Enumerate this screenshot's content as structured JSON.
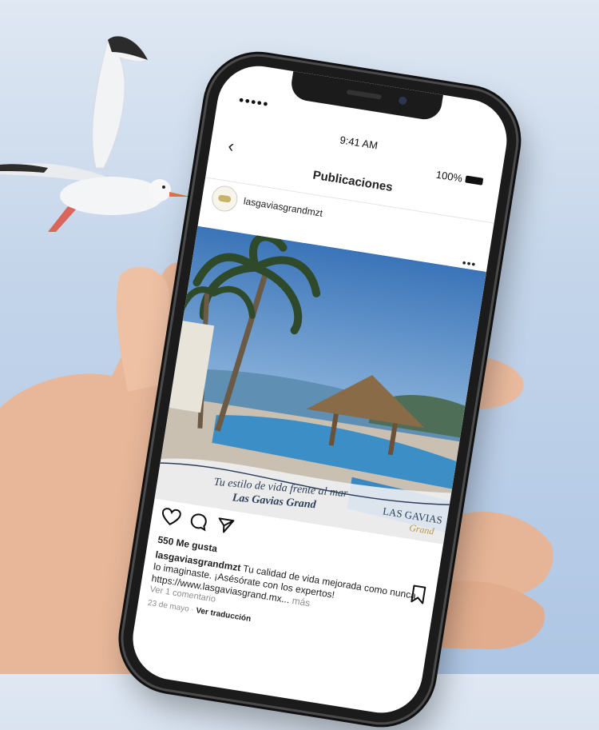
{
  "status_bar": {
    "signal": "●●●●●",
    "time": "9:41 AM",
    "battery": "100%"
  },
  "nav": {
    "back_icon": "chevron-left-icon",
    "title": "Publicaciones"
  },
  "post": {
    "username": "lasgaviasgrandmzt",
    "more_icon": "more-horizontal-icon",
    "image": {
      "tagline_1": "Tu estilo de vida frente al mar",
      "tagline_2": "Las Gavias Grand",
      "logo_1": "LAS GAVIAS",
      "logo_2": "Grand"
    },
    "likes": "550 Me gusta",
    "caption_user": "lasgaviasgrandmzt",
    "caption_text": " Tu calidad de vida mejorada como nunca lo imaginaste. ¡Asésórate con los expertos! https://www.lasgaviasgrand.mx...",
    "caption_more": "más",
    "comments_link": "Ver 1 comentario",
    "date": "23 de mayo",
    "separator": " · ",
    "translate_link": "Ver traducción"
  },
  "icons": [
    "heart-icon",
    "comment-icon",
    "share-icon",
    "bookmark-icon"
  ],
  "colors": {
    "sky": "#c4d5ea",
    "phone_frame": "#1b1b1c",
    "text": "#222222",
    "muted": "#8e8e8e"
  }
}
